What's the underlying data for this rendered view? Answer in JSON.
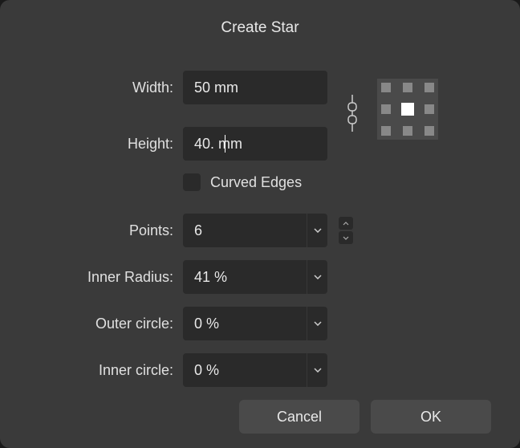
{
  "title": "Create Star",
  "fields": {
    "width": {
      "label": "Width:",
      "value": "50 mm"
    },
    "height": {
      "label": "Height:",
      "value": "40. mm"
    },
    "curved_edges": {
      "label": "Curved Edges",
      "checked": false
    },
    "points": {
      "label": "Points:",
      "value": "6"
    },
    "inner_radius": {
      "label": "Inner Radius:",
      "value": "41 %"
    },
    "outer_circle": {
      "label": "Outer circle:",
      "value": "0 %"
    },
    "inner_circle": {
      "label": "Inner circle:",
      "value": "0 %"
    }
  },
  "buttons": {
    "cancel": "Cancel",
    "ok": "OK"
  }
}
